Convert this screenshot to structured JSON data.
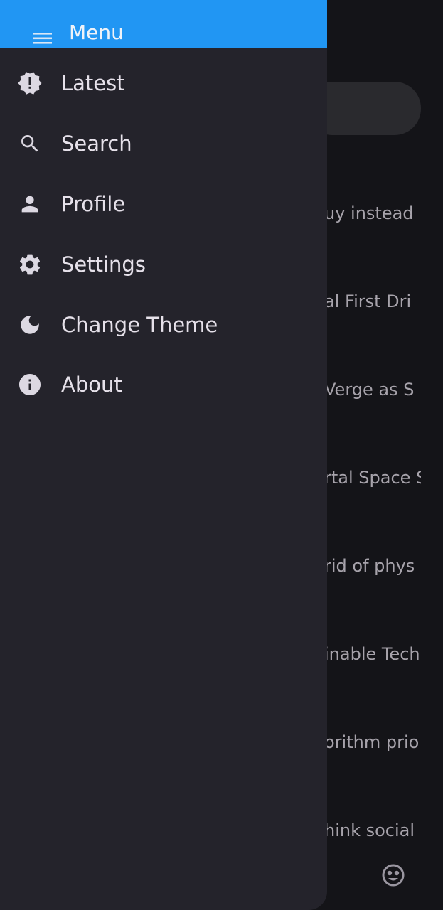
{
  "background": {
    "list_items": [
      "uy instead",
      "al First Dri",
      "Verge as S",
      "rtal Space S",
      "rid of phys",
      "inable Tech",
      "orithm prio",
      "hink social"
    ],
    "bottom_icon": "emoji-face-icon"
  },
  "drawer": {
    "header": {
      "title": "Menu",
      "icon": "hamburger-menu-icon",
      "color": "#2196F3"
    },
    "items": [
      {
        "label": "Latest",
        "icon": "new-releases-icon"
      },
      {
        "label": "Search",
        "icon": "search-icon"
      },
      {
        "label": "Profile",
        "icon": "person-icon"
      },
      {
        "label": "Settings",
        "icon": "gear-icon"
      },
      {
        "label": "Change Theme",
        "icon": "moon-icon"
      },
      {
        "label": "About",
        "icon": "info-icon"
      }
    ]
  }
}
